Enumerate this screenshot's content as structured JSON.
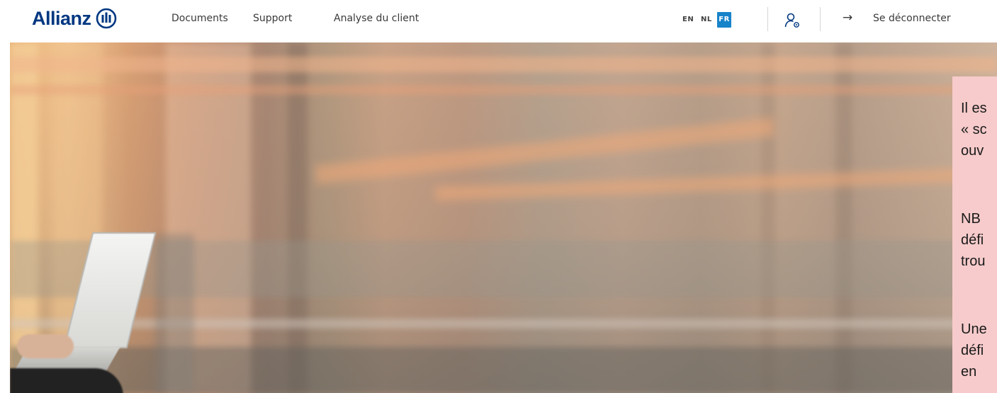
{
  "brand": {
    "name": "Allianz"
  },
  "nav": {
    "links": [
      {
        "label": "Documents"
      },
      {
        "label": "Support"
      },
      {
        "label": "Analyse du client"
      }
    ]
  },
  "languages": {
    "options": [
      "EN",
      "NL",
      "FR"
    ],
    "selected": "FR"
  },
  "header_actions": {
    "user_icon": "user-settings-icon",
    "logout_icon": "arrow-right-icon",
    "logout_label": "Se déconnecter"
  },
  "note_panel": {
    "paragraphs": [
      "Il es\n« sc\nouv",
      "NB\ndéfi\ntrou",
      "Une\ndéfi\nen"
    ]
  },
  "colors": {
    "brand_blue": "#003781",
    "language_active": "#1783c9",
    "note_background": "#f7cbcb"
  }
}
